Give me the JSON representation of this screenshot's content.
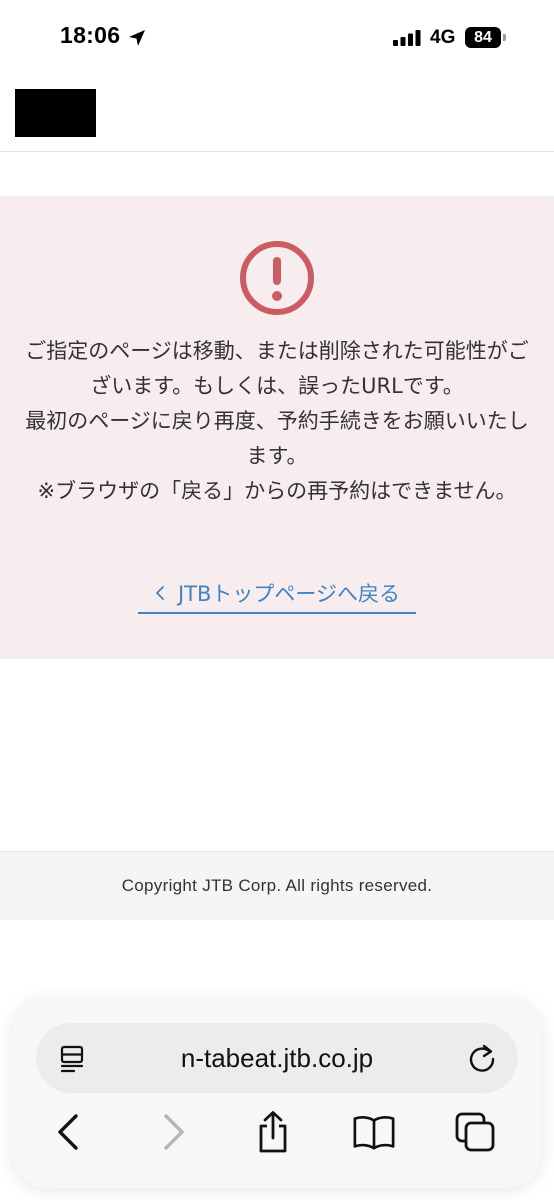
{
  "status_bar": {
    "time": "18:06",
    "network": "4G",
    "battery": "84"
  },
  "error": {
    "lines": [
      "ご指定のページは移動、または削除された可能性がございます。もしくは、誤ったURLです。",
      "最初のページに戻り再度、予約手続きをお願いいたします。",
      "※ブラウザの「戻る」からの再予約はできません。"
    ],
    "back_link": "JTBトップページへ戻る"
  },
  "footer": {
    "copyright": "Copyright JTB Corp. All rights reserved."
  },
  "browser": {
    "url": "n-tabeat.jtb.co.jp"
  },
  "colors": {
    "panel_background": "#f7ecee",
    "alert_accent": "#cc5c63",
    "link_accent": "#3f84c4"
  },
  "icons": [
    "location-arrow-icon",
    "signal-bars-icon",
    "battery-icon",
    "alert-exclamation-icon",
    "chevron-left-icon",
    "reader-icon",
    "reload-icon",
    "back-arrow-icon",
    "forward-arrow-icon",
    "share-icon",
    "bookmarks-icon",
    "tabs-icon"
  ]
}
